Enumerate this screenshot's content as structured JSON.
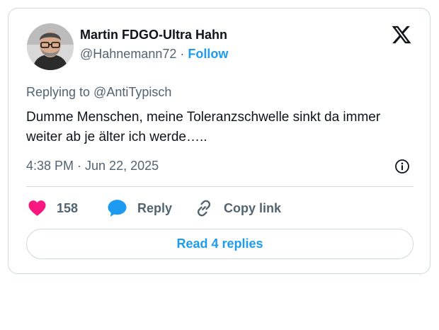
{
  "author": {
    "name": "Martin FDGO-Ultra Hahn",
    "handle": "@Hahnemann72",
    "separator": "·",
    "follow_label": "Follow"
  },
  "tweet": {
    "replying_to": "Replying to @AntiTypisch",
    "text": "Dumme Menschen, meine Toleranzschwelle sinkt da immer weiter ab je älter ich werde…..",
    "timestamp": "4:38 PM · Jun 22, 2025"
  },
  "actions": {
    "like_count": "158",
    "reply_label": "Reply",
    "copy_link_label": "Copy link"
  },
  "read_replies_label": "Read 4 replies",
  "colors": {
    "accent": "#1d9bf0",
    "like": "#f91880",
    "text": "#0f1419",
    "muted": "#536471",
    "border": "#cfd9de"
  },
  "icons": [
    "x-logo-icon",
    "info-icon",
    "heart-icon",
    "reply-bubble-icon",
    "link-icon"
  ]
}
